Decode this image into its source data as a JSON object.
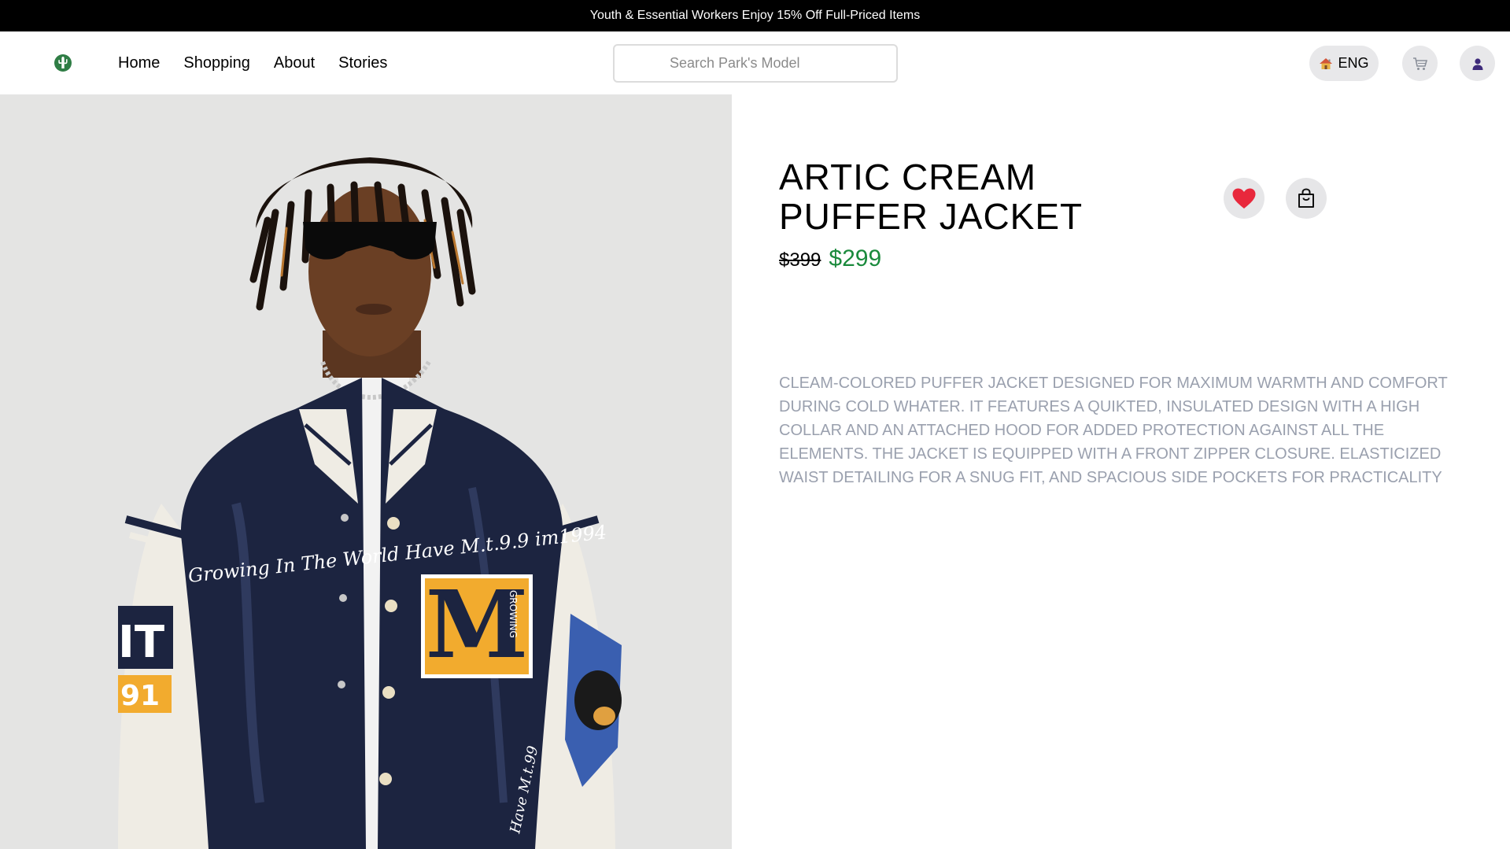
{
  "promo": {
    "text": "Youth & Essential Workers Enjoy 15% Off Full-Priced Items"
  },
  "nav": {
    "links": [
      {
        "label": "Home"
      },
      {
        "label": "Shopping"
      },
      {
        "label": "About"
      },
      {
        "label": "Stories"
      }
    ],
    "logo_icon": "cactus-logo-icon",
    "search": {
      "placeholder": "Search Park's Model",
      "value": ""
    },
    "language": {
      "label": "ENG",
      "icon": "house-icon"
    },
    "cart_icon": "cart-icon",
    "account_icon": "user-icon"
  },
  "product": {
    "title": "ARTIC CREAM PUFFER JACKET",
    "old_price": "$399",
    "price": "$299",
    "description": "CLEAM-COLORED PUFFER JACKET DESIGNED FOR MAXIMUM WARMTH AND COMFORT DURING COLD WHATER. IT FEATURES A QUIKTED, INSULATED DESIGN WITH A HIGH COLLAR AND AN ATTACHED HOOD FOR ADDED PROTECTION AGAINST ALL THE ELEMENTS. THE JACKET IS EQUIPPED WITH A FRONT ZIPPER CLOSURE. ELASTICIZED WAIST DETAILING FOR A SNUG FIT, AND SPACIOUS SIDE POCKETS FOR PRACTICALITY",
    "image": {
      "chest_text": "Growing In The World Have M.t.9.9 im1994",
      "letter_patch": "M",
      "patch_side_text": "GROWING",
      "sleeve_letters": "IT",
      "sleeve_number": "91",
      "pocket_text": "Have M.t.99"
    },
    "favorite_icon": "heart-icon",
    "bag_icon": "shopping-bag-icon"
  },
  "colors": {
    "promo_bg": "#000000",
    "new_price": "#1a8a3c",
    "description": "#9aa0ae",
    "hero_bg": "#e4e4e3",
    "jacket_navy": "#1c2440",
    "sleeve_cream": "#efece4",
    "patch_yellow": "#f2ab2e",
    "heart_red": "#e8283c"
  }
}
